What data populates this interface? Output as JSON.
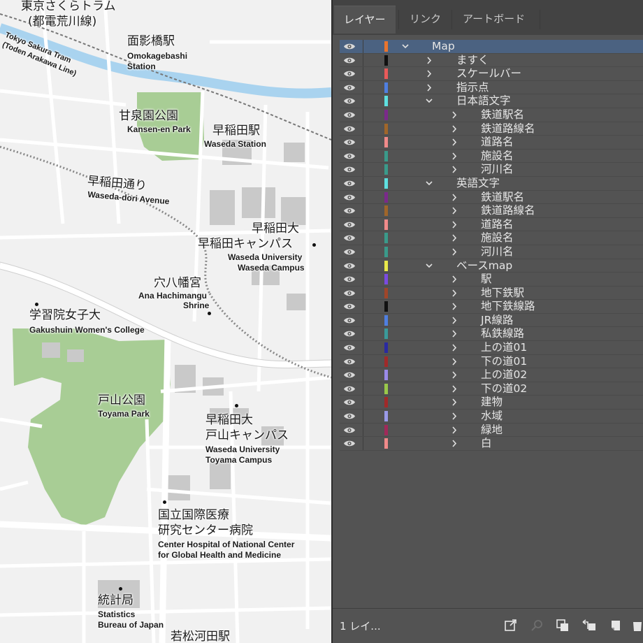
{
  "map": {
    "labels": {
      "tram_ja": "東京さくらトラム",
      "tram_ja2": "(都電荒川線)",
      "tram_en": "Tokyo Sakura Tram",
      "tram_en2": "(Toden Arakawa Line)",
      "omokagebashi_ja": "面影橋駅",
      "omokagebashi_en": "Omokagebashi",
      "omokagebashi_en2": "Station",
      "kansen_ja": "甘泉園公園",
      "kansen_en": "Kansen-en Park",
      "waseda_st_ja": "早稲田駅",
      "waseda_st_en": "Waseda Station",
      "waseda_dori_ja": "早稲田通り",
      "waseda_dori_en": "Waseda-dori Avenue",
      "waseda_univ_ja": "早稲田大",
      "waseda_campus_ja": "早稲田キャンパス",
      "waseda_univ_en": "Waseda University",
      "waseda_campus_en": "Waseda Campus",
      "anahachiman_ja": "穴八幡宮",
      "anahachiman_en": "Ana Hachimangu",
      "anahachiman_en2": "Shrine",
      "gakushuin_ja": "学習院女子大",
      "gakushuin_en": "Gakushuin Women's College",
      "toyama_park_ja": "戸山公園",
      "toyama_park_en": "Toyama Park",
      "toyama_univ_ja": "早稲田大",
      "toyama_campus_ja": "戸山キャンパス",
      "toyama_univ_en": "Waseda University",
      "toyama_campus_en": "Toyama Campus",
      "ncgm_ja": "国立国際医療",
      "ncgm_ja2": "研究センター病院",
      "ncgm_en": "Center Hospital of National Center",
      "ncgm_en2": "for Global Health and Medicine",
      "stats_ja": "統計局",
      "stats_en": "Statistics",
      "stats_en2": "Bureau of Japan",
      "wakamatsu_ja": "若松河田駅"
    }
  },
  "panel": {
    "tabs": [
      "レイヤー",
      "リンク",
      "アートボード"
    ],
    "layers": [
      {
        "name": "Map",
        "color": "#e8742e",
        "level": 0,
        "expanded": true,
        "selected": true
      },
      {
        "name": "ますく",
        "color": "#111111",
        "level": 1,
        "expanded": false
      },
      {
        "name": "スケールバー",
        "color": "#e85a5a",
        "level": 1,
        "expanded": false
      },
      {
        "name": "指示点",
        "color": "#4f7fe0",
        "level": 1,
        "expanded": false
      },
      {
        "name": "日本語文字",
        "color": "#5ee0e0",
        "level": 1,
        "expanded": true
      },
      {
        "name": "鉄道駅名",
        "color": "#7a2a8a",
        "level": 2,
        "expanded": false
      },
      {
        "name": "鉄道路線名",
        "color": "#a0662a",
        "level": 2,
        "expanded": false
      },
      {
        "name": "道路名",
        "color": "#f08a8a",
        "level": 2,
        "expanded": false
      },
      {
        "name": "施設名",
        "color": "#3a9a8a",
        "level": 2,
        "expanded": false
      },
      {
        "name": "河川名",
        "color": "#3a9a8a",
        "level": 2,
        "expanded": false
      },
      {
        "name": "英語文字",
        "color": "#5ee0e0",
        "level": 1,
        "expanded": true
      },
      {
        "name": "鉄道駅名",
        "color": "#7a2a8a",
        "level": 2,
        "expanded": false
      },
      {
        "name": "鉄道路線名",
        "color": "#a0662a",
        "level": 2,
        "expanded": false
      },
      {
        "name": "道路名",
        "color": "#f08a8a",
        "level": 2,
        "expanded": false
      },
      {
        "name": "施設名",
        "color": "#3a9a8a",
        "level": 2,
        "expanded": false
      },
      {
        "name": "河川名",
        "color": "#3a9a8a",
        "level": 2,
        "expanded": false
      },
      {
        "name": "ベースmap",
        "color": "#e8e84a",
        "level": 1,
        "expanded": true
      },
      {
        "name": "駅",
        "color": "#7a4ae0",
        "level": 2,
        "expanded": false
      },
      {
        "name": "地下鉄駅",
        "color": "#a0462a",
        "level": 2,
        "expanded": false
      },
      {
        "name": "地下鉄線路",
        "color": "#111111",
        "level": 2,
        "expanded": false
      },
      {
        "name": "JR線路",
        "color": "#4f7fe0",
        "level": 2,
        "expanded": false
      },
      {
        "name": "私鉄線路",
        "color": "#3a9a9a",
        "level": 2,
        "expanded": false
      },
      {
        "name": "上の道01",
        "color": "#2a2aa0",
        "level": 2,
        "expanded": false
      },
      {
        "name": "下の道01",
        "color": "#a02a2a",
        "level": 2,
        "expanded": false
      },
      {
        "name": "上の道02",
        "color": "#9a8ae8",
        "level": 2,
        "expanded": false
      },
      {
        "name": "下の道02",
        "color": "#9ac84a",
        "level": 2,
        "expanded": false
      },
      {
        "name": "建物",
        "color": "#a02a2a",
        "level": 2,
        "expanded": false
      },
      {
        "name": "水域",
        "color": "#9a9ae8",
        "level": 2,
        "expanded": false
      },
      {
        "name": "緑地",
        "color": "#a02a5a",
        "level": 2,
        "expanded": false
      },
      {
        "name": "白",
        "color": "#f08a8a",
        "level": 2,
        "expanded": false
      }
    ],
    "footer": {
      "count": "1 レイ..."
    }
  }
}
